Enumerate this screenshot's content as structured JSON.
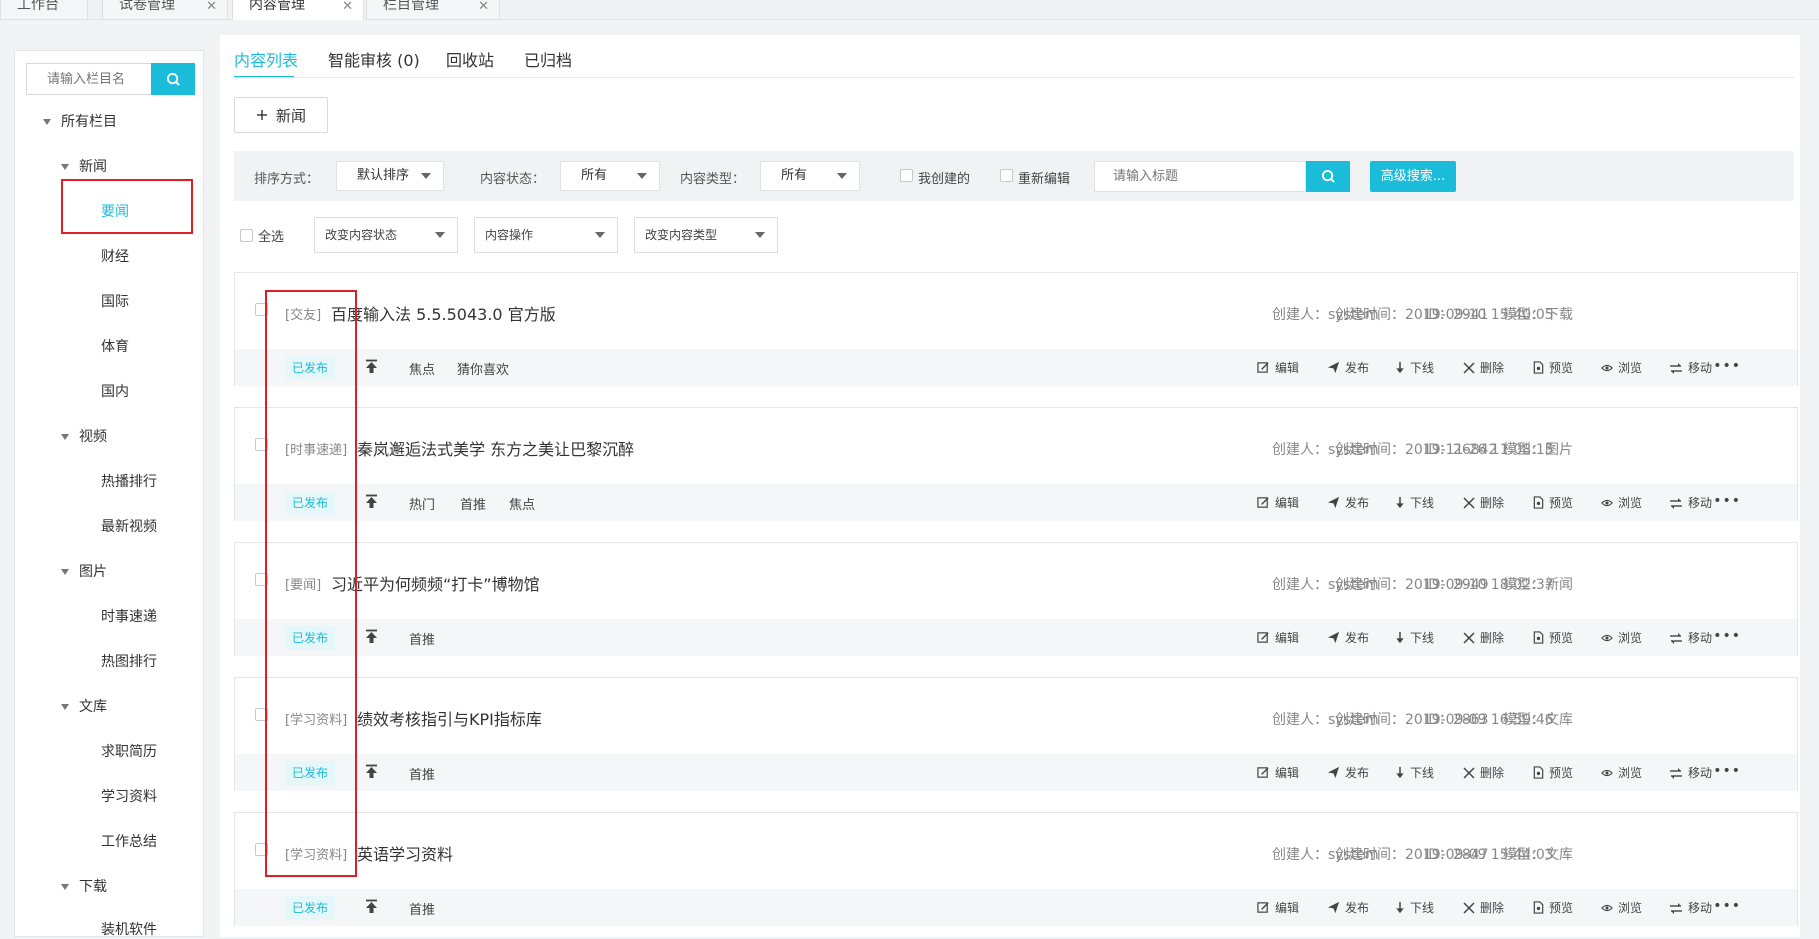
{
  "top_tabs": [
    {
      "label": "工作台",
      "closable": false
    },
    {
      "label": "试卷管理",
      "closable": true
    },
    {
      "label": "内容管理",
      "closable": true,
      "active": true
    },
    {
      "label": "栏目管理",
      "closable": true
    }
  ],
  "tree": {
    "search_placeholder": "请输入栏目名",
    "root": "所有栏目",
    "groups": [
      {
        "label": "新闻",
        "children": [
          "要闻",
          "财经",
          "国际",
          "体育",
          "国内"
        ]
      },
      {
        "label": "视频",
        "children": [
          "热播排行",
          "最新视频"
        ]
      },
      {
        "label": "图片",
        "children": [
          "时事速递",
          "热图排行"
        ]
      },
      {
        "label": "文库",
        "children": [
          "求职简历",
          "学习资料",
          "工作总结"
        ]
      },
      {
        "label": "下载",
        "children": [
          "装机软件"
        ]
      }
    ]
  },
  "main": {
    "tabs": [
      "内容列表",
      "智能审核 (0)",
      "回收站",
      "已归档"
    ],
    "new_button": "新闻",
    "filters": {
      "sort_label": "排序方式：",
      "sort_value": "默认排序",
      "status_label": "内容状态：",
      "status_value": "所有",
      "type_label": "内容类型：",
      "type_value": "所有",
      "mine_label": "我创建的",
      "reedit_label": "重新编辑",
      "title_placeholder": "请输入标题",
      "advanced_label": "高级搜索..."
    },
    "bulk": {
      "select_all": "全选",
      "change_status": "改变内容状态",
      "content_ops": "内容操作",
      "change_type": "改变内容类型"
    },
    "actions": [
      "编辑",
      "发布",
      "下线",
      "删除",
      "预览",
      "浏览",
      "移动"
    ],
    "items": [
      {
        "category": "[交友]",
        "title": "百度输入法 5.5.5043.0 官方版",
        "creator": "创建人：system",
        "created": "创建时间：2019-09-10 15:40:05",
        "id": "ID：2941",
        "model": "模型：下载",
        "status": "已发布",
        "tags": [
          "焦点",
          "猜你喜欢"
        ]
      },
      {
        "category": "[时事速递]",
        "title": "秦岚邂逅法式美学 东方之美让巴黎沉醉",
        "creator": "创建人：system",
        "created": "创建时间：2019-11-26 11:08:15",
        "id": "ID：26842",
        "model": "模型：图片",
        "status": "已发布",
        "tags": [
          "热门",
          "首推",
          "焦点"
        ]
      },
      {
        "category": "[要闻]",
        "title": "习近平为何频频“打卡”博物馆",
        "creator": "创建人：system",
        "created": "创建时间：2019-09-10 18:02:37",
        "id": "ID：2949",
        "model": "模型：新闻",
        "status": "已发布",
        "tags": [
          "首推"
        ]
      },
      {
        "category": "[学习资料]",
        "title": "绩效考核指引与KPI指标库",
        "creator": "创建人：system",
        "created": "创建时间：2019-09-09 16:59:46",
        "id": "ID：2863",
        "model": "模型：文库",
        "status": "已发布",
        "tags": [
          "首推"
        ]
      },
      {
        "category": "[学习资料]",
        "title": "英语学习资料",
        "creator": "创建人：system",
        "created": "创建时间：2019-09-09 15:44:03",
        "id": "ID：2847",
        "model": "模型：文库",
        "status": "已发布",
        "tags": [
          "首推"
        ]
      }
    ]
  },
  "colors": {
    "accent": "#1bbcd9",
    "highlight": "#e02020"
  }
}
